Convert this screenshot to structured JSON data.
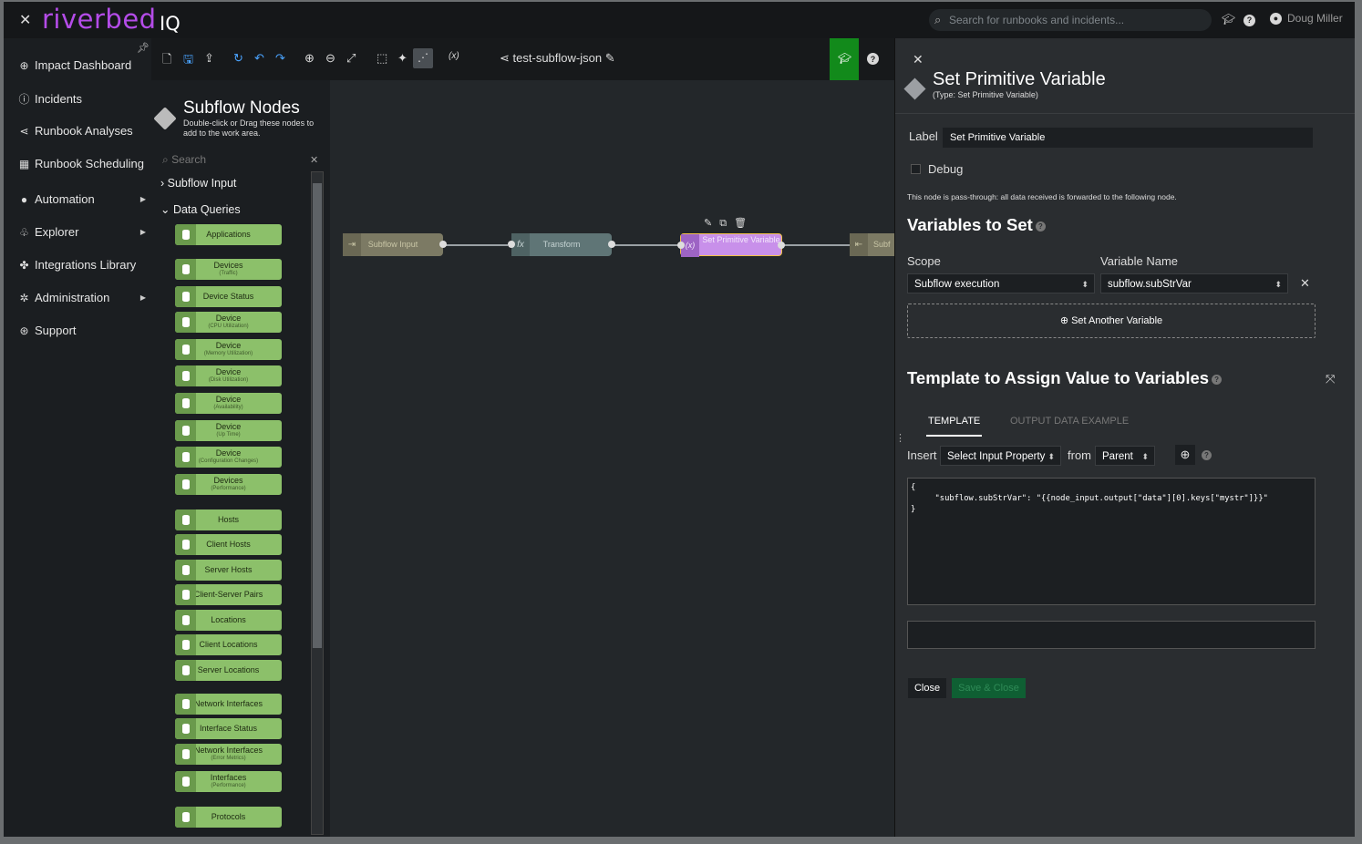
{
  "brand": {
    "name": "riverbed",
    "suffix": "IQ"
  },
  "topbar": {
    "search_placeholder": "Search for runbooks and incidents...",
    "user": "Doug Miller"
  },
  "nav": {
    "items": [
      {
        "label": "Impact Dashboard",
        "icon": "globe-icon"
      },
      {
        "label": "Incidents",
        "icon": "alert-circle-icon"
      },
      {
        "label": "Runbook Analyses",
        "icon": "flow-icon"
      },
      {
        "label": "Runbook Scheduling",
        "icon": "calendar-icon"
      },
      {
        "label": "Automation",
        "icon": "bolt-icon"
      },
      {
        "label": "Explorer",
        "icon": "explorer-icon"
      },
      {
        "label": "Integrations Library",
        "icon": "puzzle-icon"
      },
      {
        "label": "Administration",
        "icon": "gear-icon"
      },
      {
        "label": "Support",
        "icon": "support-icon"
      }
    ]
  },
  "toolbar": {
    "flow_name": "test-subflow-json",
    "vars_label": "(x)"
  },
  "palette": {
    "title": "Subflow Nodes",
    "description": "Double-click or Drag these nodes to add to the work area.",
    "search_placeholder": "Search",
    "groups": [
      "Subflow Input",
      "Data Queries"
    ],
    "nodes": [
      {
        "label": "Applications",
        "sub": ""
      },
      {
        "label": "Devices",
        "sub": "(Traffic)"
      },
      {
        "label": "Device Status",
        "sub": ""
      },
      {
        "label": "Device",
        "sub": "(CPU Utilization)"
      },
      {
        "label": "Device",
        "sub": "(Memory Utilization)"
      },
      {
        "label": "Device",
        "sub": "(Disk Utilization)"
      },
      {
        "label": "Device",
        "sub": "(Availability)"
      },
      {
        "label": "Device",
        "sub": "(Up Time)"
      },
      {
        "label": "Device",
        "sub": "(Configuration Changes)"
      },
      {
        "label": "Devices",
        "sub": "(Performance)"
      },
      {
        "label": "Hosts",
        "sub": ""
      },
      {
        "label": "Client Hosts",
        "sub": ""
      },
      {
        "label": "Server Hosts",
        "sub": ""
      },
      {
        "label": "Client-Server Pairs",
        "sub": ""
      },
      {
        "label": "Locations",
        "sub": ""
      },
      {
        "label": "Client Locations",
        "sub": ""
      },
      {
        "label": "Server Locations",
        "sub": ""
      },
      {
        "label": "Network Interfaces",
        "sub": ""
      },
      {
        "label": "Interface Status",
        "sub": ""
      },
      {
        "label": "Network Interfaces",
        "sub": "(Error Metrics)"
      },
      {
        "label": "Interfaces",
        "sub": "(Performance)"
      },
      {
        "label": "Protocols",
        "sub": ""
      }
    ]
  },
  "canvas": {
    "nodes": [
      {
        "label": "Subflow Input",
        "icon": "subflow-input-icon"
      },
      {
        "label": "Transform",
        "icon": "fx-icon"
      },
      {
        "label": "Set Primitive Variable",
        "icon": "variable-icon"
      },
      {
        "label": "Subf",
        "icon": "subflow-output-icon"
      }
    ]
  },
  "panel": {
    "title": "Set Primitive Variable",
    "subtitle": "(Type: Set Primitive Variable)",
    "label_caption": "Label",
    "label_value": "Set Primitive Variable",
    "debug_label": "Debug",
    "pass_through_note": "This node is pass-through: all data received is forwarded to the following node.",
    "variables_heading": "Variables to Set",
    "scope_caption": "Scope",
    "scope_value": "Subflow execution",
    "varname_caption": "Variable Name",
    "varname_value": "subflow.subStrVar",
    "set_another": "Set Another Variable",
    "template_heading": "Template to Assign Value to Variables",
    "tabs": [
      "TEMPLATE",
      "OUTPUT DATA EXAMPLE"
    ],
    "insert_caption": "Insert",
    "insert_value": "Select Input Property",
    "from_caption": "from",
    "from_value": "Parent",
    "code": "{\n     \"subflow.subStrVar\": \"{{node_input.output[\"data\"][0].keys[\"mystr\"]}}\"\n}",
    "close_button": "Close",
    "save_button": "Save & Close"
  }
}
